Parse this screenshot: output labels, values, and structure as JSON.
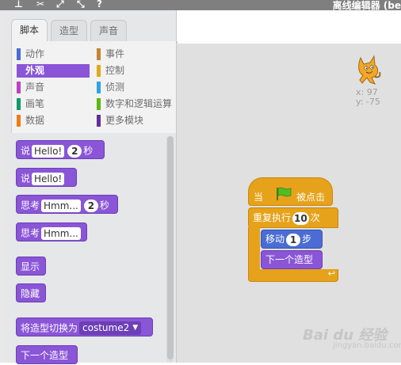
{
  "app": {
    "title": "离线编辑器 (be"
  },
  "toolbar_icons": [
    "duplicate-icon",
    "cut-icon",
    "grow-icon",
    "shrink-icon",
    "help-icon"
  ],
  "tabs": [
    {
      "label": "脚本",
      "active": true
    },
    {
      "label": "造型",
      "active": false
    },
    {
      "label": "声音",
      "active": false
    }
  ],
  "categories": [
    {
      "label": "动作",
      "color": "#4a6cd4"
    },
    {
      "label": "外观",
      "color": "#8a55d7",
      "selected": true
    },
    {
      "label": "声音",
      "color": "#bb42c3"
    },
    {
      "label": "画笔",
      "color": "#0e9a6c"
    },
    {
      "label": "数据",
      "color": "#ee7d16"
    },
    {
      "label": "事件",
      "color": "#c88330"
    },
    {
      "label": "控制",
      "color": "#e1a91a"
    },
    {
      "label": "侦测",
      "color": "#2ca5e2"
    },
    {
      "label": "数字和逻辑运算",
      "color": "#5cb712"
    },
    {
      "label": "更多模块",
      "color": "#632d99"
    }
  ],
  "palette_blocks": {
    "say_secs": {
      "prefix": "说",
      "text": "Hello!",
      "secs": "2",
      "suffix": "秒"
    },
    "say": {
      "prefix": "说",
      "text": "Hello!"
    },
    "think_secs": {
      "prefix": "思考",
      "text": "Hmm...",
      "secs": "2",
      "suffix": "秒"
    },
    "think": {
      "prefix": "思考",
      "text": "Hmm..."
    },
    "show": "显示",
    "hide": "隐藏",
    "switch_costume": {
      "prefix": "将造型切换为",
      "value": "costume2"
    },
    "next_costume": "下一个造型"
  },
  "sprite": {
    "x_label": "x:",
    "x": "97",
    "y_label": "y:",
    "y": "-75"
  },
  "script": {
    "hat": {
      "when": "当",
      "clicked": "被点击"
    },
    "repeat": {
      "label": "重复执行",
      "count": "10",
      "suffix": "次"
    },
    "move": {
      "label": "移动",
      "steps": "1",
      "suffix": "步"
    },
    "next_costume": "下一个造型"
  },
  "watermark": {
    "brand": "Bai du 经验",
    "sub": "jingyan.baidu.com"
  }
}
